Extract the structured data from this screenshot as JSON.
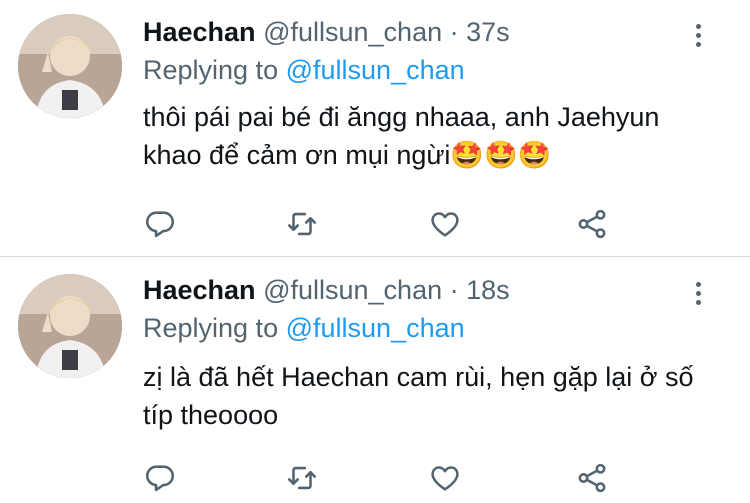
{
  "tweets": [
    {
      "name": "Haechan",
      "handle": "@fullsun_chan",
      "separator": "·",
      "time": "37s",
      "replying_prefix": "Replying to",
      "replying_to": "@fullsun_chan",
      "text": "thôi pái pai bé đi ăngg nhaaa, anh Jaehyun khao để cảm ơn mụi ngừi🤩🤩🤩",
      "icons": [
        "reply-icon",
        "retweet-icon",
        "like-icon",
        "share-icon",
        "more-icon"
      ]
    },
    {
      "name": "Haechan",
      "handle": "@fullsun_chan",
      "separator": "·",
      "time": "18s",
      "replying_prefix": "Replying to",
      "replying_to": "@fullsun_chan",
      "text": "zị là đã hết Haechan cam rùi, hẹn gặp lại ở số típ theoooo",
      "icons": [
        "reply-icon",
        "retweet-icon",
        "like-icon",
        "share-icon",
        "more-icon"
      ]
    }
  ],
  "colors": {
    "text_primary": "#0f1419",
    "text_secondary": "#536471",
    "link": "#1d9bf0",
    "divider": "#cfd9de"
  }
}
